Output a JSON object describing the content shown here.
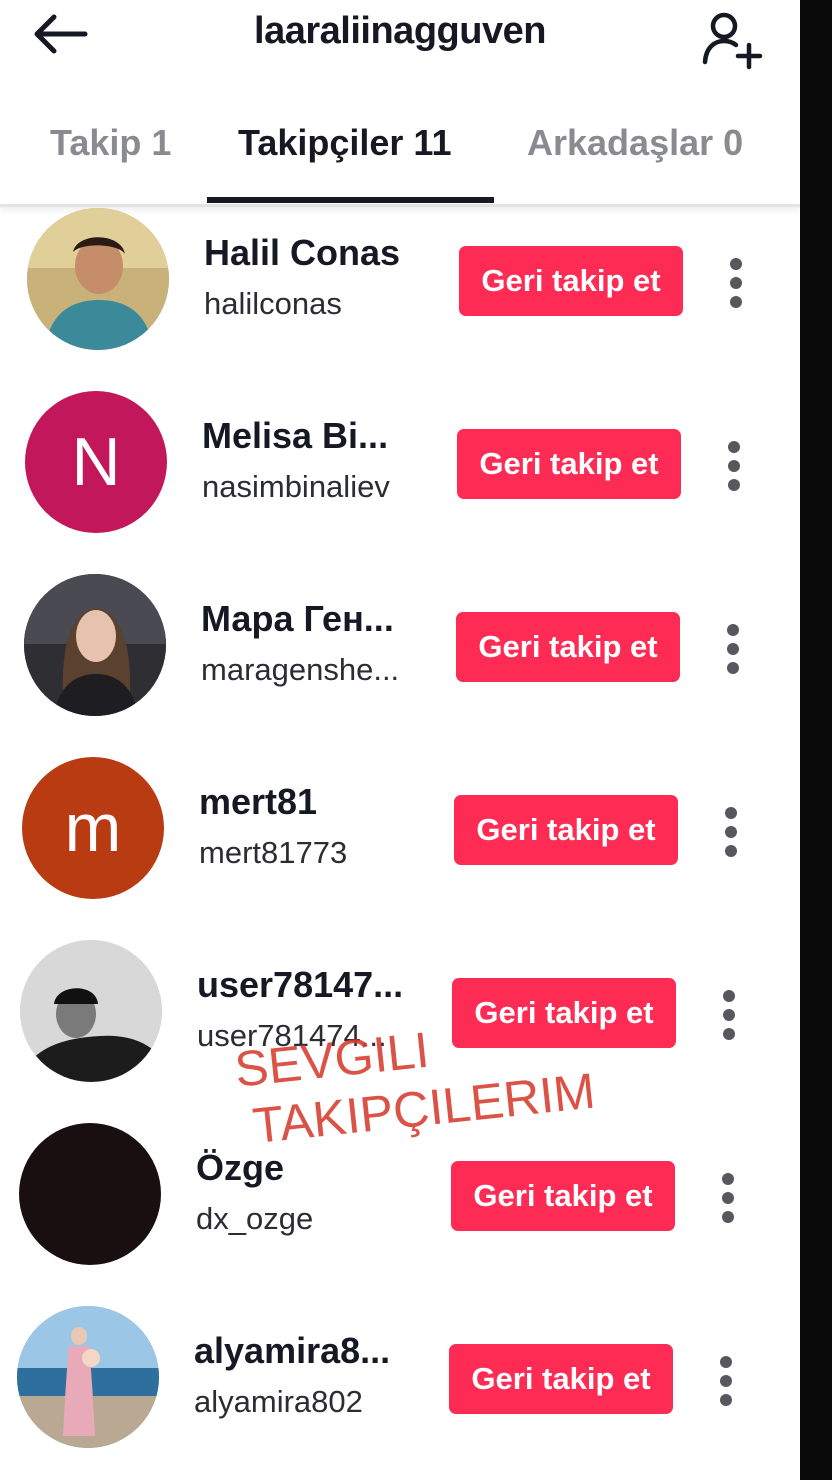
{
  "header": {
    "title": "laaraliinagguven",
    "back_icon": "arrow-left-icon",
    "add_icon": "add-user-icon"
  },
  "tabs": [
    {
      "label": "Takip 1",
      "active": false
    },
    {
      "label": "Takipçiler 11",
      "active": true
    },
    {
      "label": "Arkadaşlar 0",
      "active": false
    }
  ],
  "followers": [
    {
      "name": "Halil Conas",
      "handle": "halilconas",
      "button": "Geri takip et",
      "avatar": "photo",
      "avatar_letter": ""
    },
    {
      "name": "Melisa Bi...",
      "handle": "nasimbinaliev",
      "button": "Geri takip et",
      "avatar": "letter",
      "avatar_letter": "N"
    },
    {
      "name": "Мара Ген...",
      "handle": "maragenshe...",
      "button": "Geri takip et",
      "avatar": "photo",
      "avatar_letter": ""
    },
    {
      "name": "mert81",
      "handle": "mert81773",
      "button": "Geri takip et",
      "avatar": "letter",
      "avatar_letter": "m"
    },
    {
      "name": "user78147...",
      "handle": "user781474...",
      "button": "Geri takip et",
      "avatar": "photo",
      "avatar_letter": ""
    },
    {
      "name": "Özge",
      "handle": "dx_ozge",
      "button": "Geri takip et",
      "avatar": "photo",
      "avatar_letter": ""
    },
    {
      "name": "alyamira8...",
      "handle": "alyamira802",
      "button": "Geri takip et",
      "avatar": "photo",
      "avatar_letter": ""
    }
  ],
  "overlay": {
    "line1": "SEVGILI",
    "line2": "TAKIPÇILERIM"
  },
  "colors": {
    "accent": "#fe2c55",
    "text": "#161823",
    "muted": "#8a8b91",
    "overlay": "#d63a2e"
  }
}
